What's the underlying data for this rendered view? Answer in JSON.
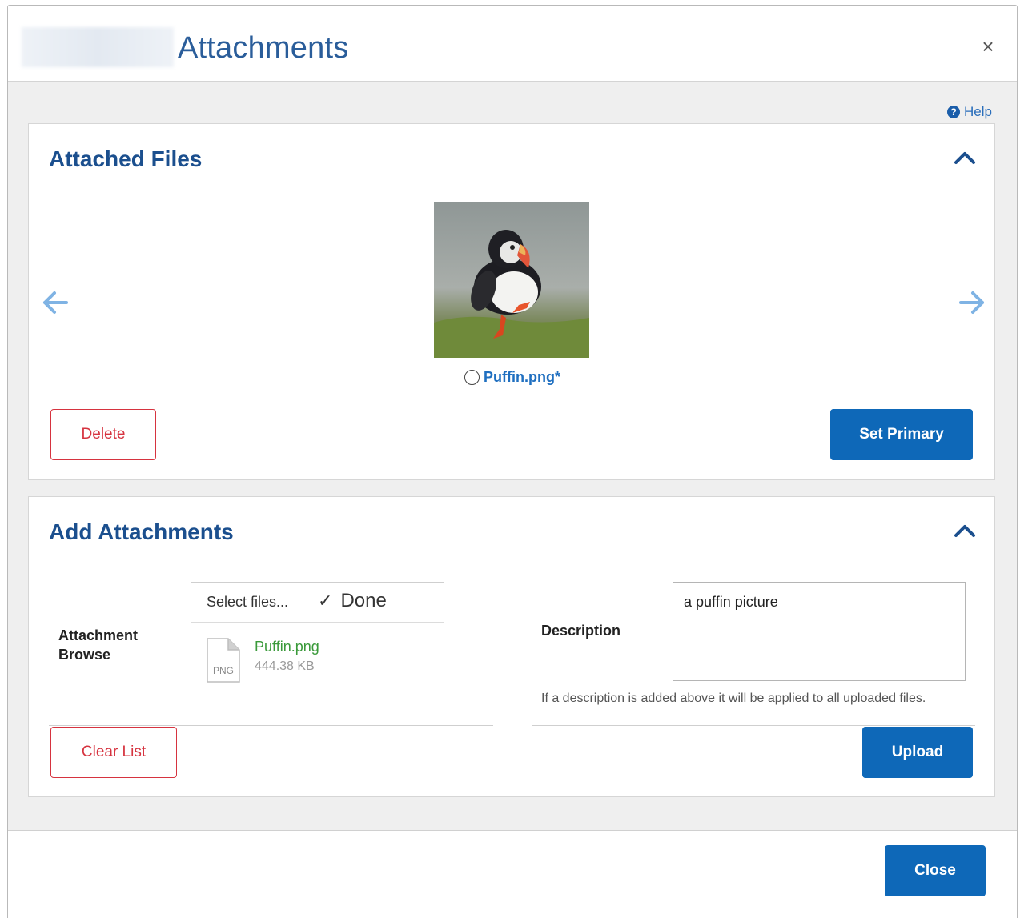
{
  "dialog": {
    "title": "Attachments",
    "close_glyph": "×"
  },
  "help": {
    "label": "Help",
    "icon_glyph": "?"
  },
  "attached_files": {
    "title": "Attached Files",
    "file_label": "Puffin.png*",
    "delete_label": "Delete",
    "set_primary_label": "Set Primary"
  },
  "add_attachments": {
    "title": "Add Attachments",
    "browse_label_line1": "Attachment",
    "browse_label_line2": "Browse",
    "select_files_label": "Select files...",
    "done_label": "Done",
    "done_glyph": "✓",
    "uploaded_file": {
      "name": "Puffin.png",
      "size": "444.38 KB",
      "type_badge": "PNG"
    },
    "description_label": "Description",
    "description_value": "a puffin picture",
    "description_hint": "If a description is added above it will be applied to all uploaded files.",
    "clear_label": "Clear List",
    "upload_label": "Upload"
  },
  "footer": {
    "close_label": "Close"
  },
  "colors": {
    "accent_blue": "#0e68b8",
    "title_blue": "#1b4f8e",
    "danger_red": "#d6333f",
    "success_green": "#3a9a3a"
  },
  "icons": [
    "close-icon",
    "help-icon",
    "chevron-up-icon",
    "arrow-left-icon",
    "arrow-right-icon",
    "checkmark-icon",
    "file-icon"
  ]
}
